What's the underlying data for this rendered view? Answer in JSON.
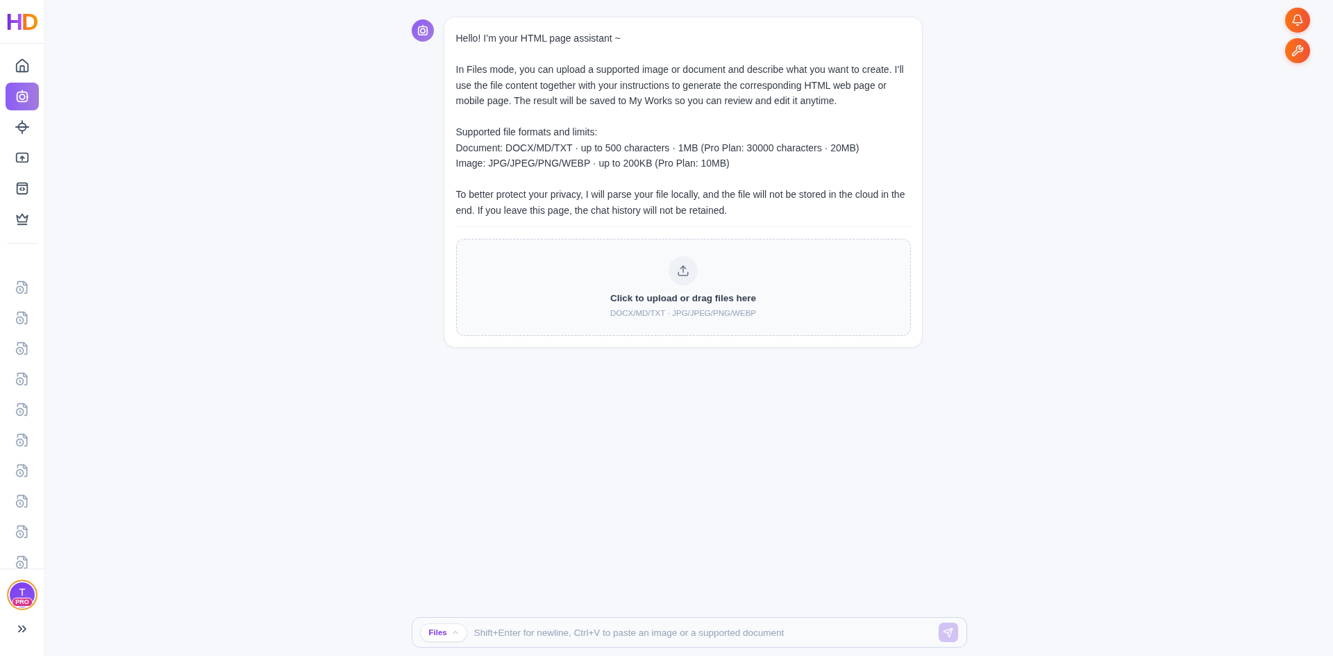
{
  "sidebar": {
    "logo": "HD",
    "nav_items": [
      {
        "kind": "home",
        "selected": false
      },
      {
        "kind": "files",
        "selected": true
      },
      {
        "kind": "target",
        "selected": false
      },
      {
        "kind": "upload",
        "selected": false
      },
      {
        "kind": "code",
        "selected": false
      },
      {
        "kind": "crown",
        "selected": false
      }
    ],
    "history_items": [
      {
        "selected": false
      },
      {
        "selected": false
      },
      {
        "selected": false
      },
      {
        "selected": false
      },
      {
        "selected": false
      },
      {
        "selected": false
      },
      {
        "selected": false
      },
      {
        "selected": false
      },
      {
        "selected": false
      },
      {
        "selected": false
      }
    ],
    "user": {
      "initial": "T",
      "badge": "PRO"
    }
  },
  "top_actions": [
    {
      "kind": "notifications"
    },
    {
      "kind": "tools"
    }
  ],
  "chat": {
    "messages": [
      {
        "paragraphs": [
          [
            "Hello! I’m your HTML page assistant ~"
          ],
          [
            "In Files mode, you can upload a supported image or document and describe what you want to create. I’ll use the file content together with your instructions to generate the corresponding HTML web page or mobile page. The result will be saved to My Works so you can review and edit it anytime."
          ],
          [
            "Supported file formats and limits:",
            "Document: DOCX/MD/TXT · up to 500 characters · 1MB (Pro Plan: 30000 characters · 20MB)",
            "Image: JPG/JPEG/PNG/WEBP · up to 200KB (Pro Plan: 10MB)"
          ],
          [
            "To better protect your privacy, I will parse your file locally, and the file will not be stored in the cloud in the end. If you leave this page, the chat history will not be retained."
          ]
        ],
        "dropzone": {
          "title": "Click to upload or drag files here",
          "formats": "DOCX/MD/TXT · JPG/JPEG/PNG/WEBP"
        }
      }
    ]
  },
  "composer": {
    "mode": {
      "label": "Files",
      "expanded": false
    },
    "placeholder": "Shift+Enter for newline, Ctrl+V to paste an image or a supported document",
    "send_button": {
      "disabled": true
    }
  }
}
